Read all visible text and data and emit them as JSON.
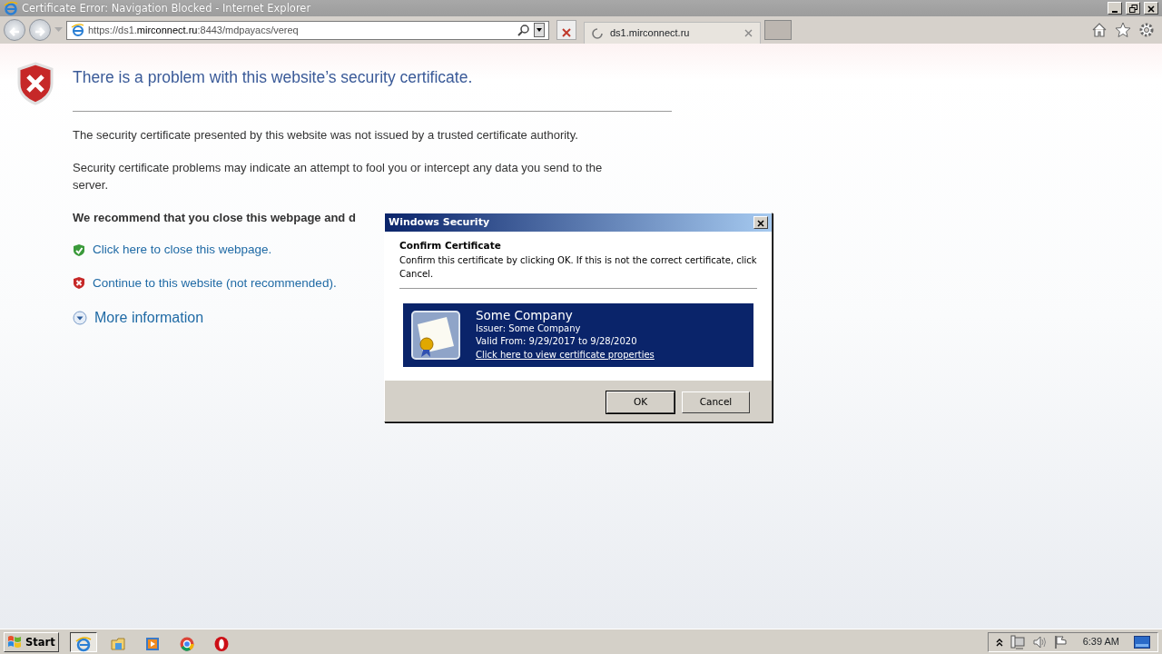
{
  "window": {
    "title": "Certificate Error: Navigation Blocked - Internet Explorer"
  },
  "address_bar": {
    "url_prefix": "https://ds1.",
    "url_host": "mirconnect.ru",
    "url_suffix": ":8443/mdpayacs/vereq"
  },
  "tabs": [
    {
      "label": "ds1.mirconnect.ru",
      "selected": true
    }
  ],
  "page": {
    "heading": "There is a problem with this website’s security certificate.",
    "paragraphs": [
      "The security certificate presented by this website was not issued by a trusted certificate authority.",
      "Security certificate problems may indicate an attempt to fool you or intercept any data you send to the server."
    ],
    "recommendation": "We recommend that you close this webpage and d",
    "links": [
      {
        "kind": "safe",
        "label": "Click here to close this webpage."
      },
      {
        "kind": "unsafe",
        "label": "Continue to this website (not recommended)."
      }
    ],
    "more_info": "More information"
  },
  "dialog": {
    "title": "Windows Security",
    "heading": "Confirm Certificate",
    "message": "Confirm this certificate by clicking OK. If this is not the correct certificate, click Cancel.",
    "certificate": {
      "name": "Some Company",
      "issuer": "Issuer: Some Company",
      "validity": "Valid From: 9/29/2017 to 9/28/2020",
      "link": "Click here to view certificate properties"
    },
    "buttons": [
      {
        "label": "OK",
        "default": true
      },
      {
        "label": "Cancel",
        "default": false
      }
    ]
  },
  "taskbar": {
    "start": "Start",
    "apps": [
      {
        "kind": "ie",
        "active": true
      },
      {
        "kind": "explorer",
        "active": false
      },
      {
        "kind": "media",
        "active": false
      },
      {
        "kind": "chrome",
        "active": false
      },
      {
        "kind": "opera",
        "active": false
      }
    ],
    "clock": "6:39 AM"
  }
}
